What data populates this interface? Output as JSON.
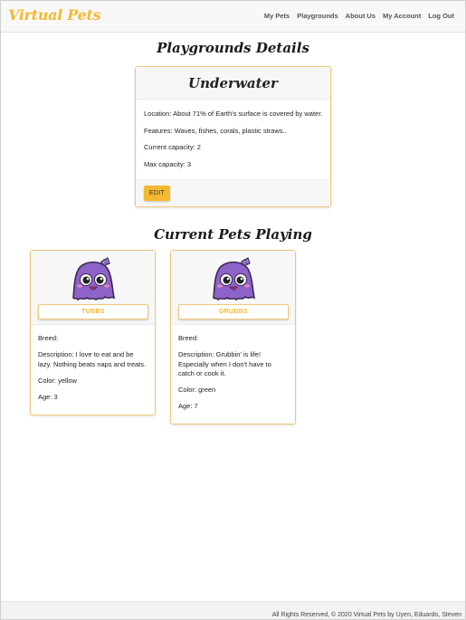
{
  "nav": {
    "brand": "Virtual Pets",
    "links": [
      "My Pets",
      "Playgrounds",
      "About Us",
      "My Account",
      "Log Out"
    ]
  },
  "page_title": "Playgrounds Details",
  "playground": {
    "name": "Underwater",
    "location": "Location: About 71% of Earth's surface is covered by water.",
    "features": "Features: Waves, fishes, corals, plastic straws..",
    "current_capacity": "Current capacity: 2",
    "max_capacity": "Max capacity: 3",
    "edit_label": "EDIT"
  },
  "pets_title": "Current Pets Playing",
  "pets": [
    {
      "name": "TUBBS",
      "breed": "Breed:",
      "description": "Description: I love to eat and be lazy. Nothing beats naps and treats.",
      "color": "Color: yellow",
      "age": "Age: 3"
    },
    {
      "name": "GRUBBS",
      "breed": "Breed:",
      "description": "Description: Grubbin' is life! Especially when I don't have to catch or cook it.",
      "color": "Color: green",
      "age": "Age: 7"
    }
  ],
  "footer": "All Rights Reserved, © 2020 Virtual Pets by Uyen, Eduardo, Steven",
  "colors": {
    "accent": "#f5b930",
    "card_border": "#f0c779",
    "pet_body": "#8e63c9"
  }
}
